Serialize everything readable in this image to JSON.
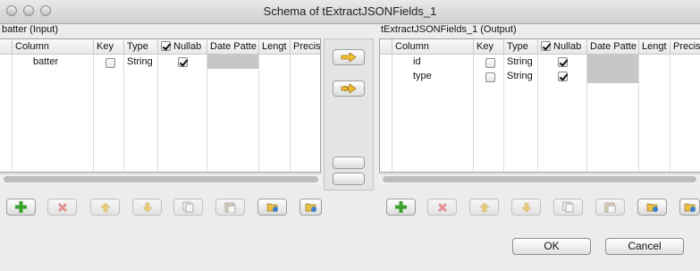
{
  "window": {
    "title": "Schema of tExtractJSONFields_1"
  },
  "input": {
    "label": "batter (Input)",
    "columns": [
      "Column",
      "Key",
      "Type",
      "Nullab",
      "Date Patte",
      "Lengt",
      "Precis"
    ],
    "rows": [
      {
        "column": "batter",
        "key": false,
        "type": "String",
        "nullable": true
      }
    ]
  },
  "output": {
    "label": "tExtractJSONFields_1 (Output)",
    "columns": [
      "Column",
      "Key",
      "Type",
      "Nullab",
      "Date Patte",
      "Lengt",
      "Precis"
    ],
    "rows": [
      {
        "column": "id",
        "key": false,
        "type": "String",
        "nullable": true
      },
      {
        "column": "type",
        "key": false,
        "type": "String",
        "nullable": true
      }
    ]
  },
  "toolbar_icons": [
    "add-icon",
    "remove-icon",
    "move-up-icon",
    "move-down-icon",
    "copy-icon",
    "paste-icon",
    "import-icon",
    "export-icon"
  ],
  "dialog": {
    "ok_label": "OK",
    "cancel_label": "Cancel"
  },
  "colors": {
    "add": "#3aa12d",
    "remove": "#d84b4b",
    "arrow": "#e8b21f"
  }
}
